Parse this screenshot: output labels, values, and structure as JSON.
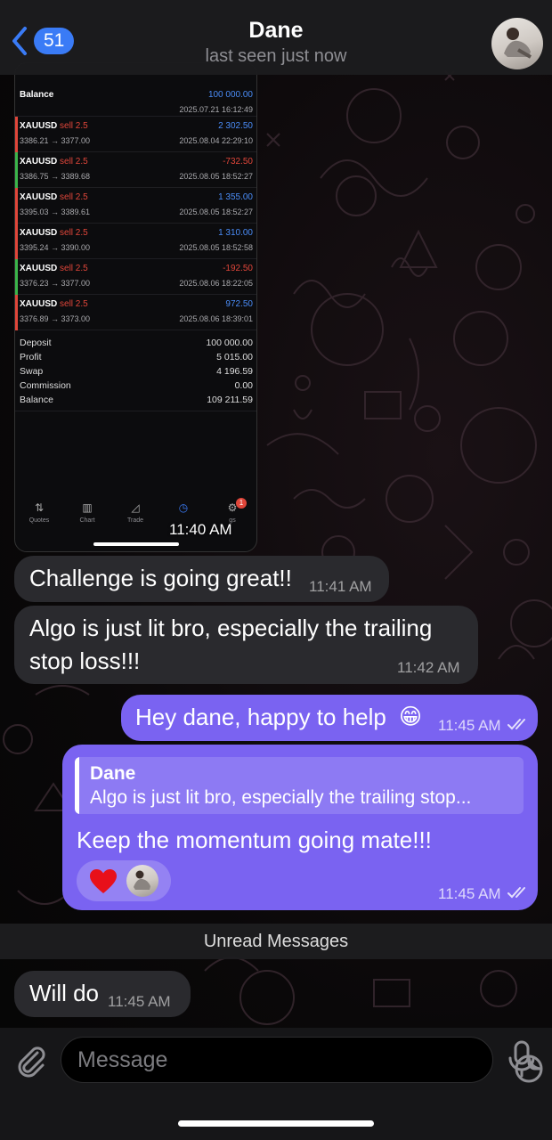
{
  "header": {
    "back_count": "51",
    "title": "Dane",
    "subtitle": "last seen just now"
  },
  "screenshot": {
    "balance_label": "Balance",
    "balance_value": "100 000.00",
    "balance_time": "2025.07.21 16:12:49",
    "trades": [
      {
        "symbol": "XAUUSD",
        "side": "sell 2.5",
        "prices": "3386.21 → 3377.00",
        "profit": "2 302.50",
        "time": "2025.08.04 22:29:10",
        "positive": true
      },
      {
        "symbol": "XAUUSD",
        "side": "sell 2.5",
        "prices": "3386.75 → 3389.68",
        "profit": "-732.50",
        "time": "2025.08.05 18:52:27",
        "positive": false
      },
      {
        "symbol": "XAUUSD",
        "side": "sell 2.5",
        "prices": "3395.03 → 3389.61",
        "profit": "1 355.00",
        "time": "2025.08.05 18:52:27",
        "positive": true
      },
      {
        "symbol": "XAUUSD",
        "side": "sell 2.5",
        "prices": "3395.24 → 3390.00",
        "profit": "1 310.00",
        "time": "2025.08.05 18:52:58",
        "positive": true
      },
      {
        "symbol": "XAUUSD",
        "side": "sell 2.5",
        "prices": "3376.23 → 3377.00",
        "profit": "-192.50",
        "time": "2025.08.06 18:22:05",
        "positive": false
      },
      {
        "symbol": "XAUUSD",
        "side": "sell 2.5",
        "prices": "3376.89 → 3373.00",
        "profit": "972.50",
        "time": "2025.08.06 18:39:01",
        "positive": true
      }
    ],
    "summary": [
      {
        "label": "Deposit",
        "value": "100 000.00"
      },
      {
        "label": "Profit",
        "value": "5 015.00"
      },
      {
        "label": "Swap",
        "value": "4 196.59"
      },
      {
        "label": "Commission",
        "value": "0.00"
      },
      {
        "label": "Balance",
        "value": "109 211.59"
      }
    ],
    "tabs": [
      "Quotes",
      "Chart",
      "Trade",
      "",
      "gs"
    ],
    "settings_badge": "1",
    "time": "11:40 AM"
  },
  "messages": {
    "m1": {
      "text": "Challenge is going great!!",
      "time": "11:41 AM"
    },
    "m2": {
      "line1": "Algo is just lit bro, especially the  trailing",
      "line2": "stop loss!!!",
      "time": "11:42 AM"
    },
    "m3": {
      "text": "Hey dane, happy to help",
      "emoji": "😁",
      "time": "11:45 AM"
    },
    "m4": {
      "reply_name": "Dane",
      "reply_text": "Algo is just lit bro, especially the trailing stop...",
      "text": "Keep the momentum going mate!!!",
      "time": "11:45 AM"
    },
    "unread": "Unread Messages",
    "m5": {
      "text": "Will do",
      "time": "11:45 AM"
    }
  },
  "input": {
    "placeholder": "Message"
  },
  "colors": {
    "outgoing_bubble": "#7a63f1",
    "incoming_bubble": "#2a2a2e",
    "accent": "#3a7bf6",
    "profit_positive": "#4a8cf7",
    "profit_negative": "#e0463a"
  }
}
